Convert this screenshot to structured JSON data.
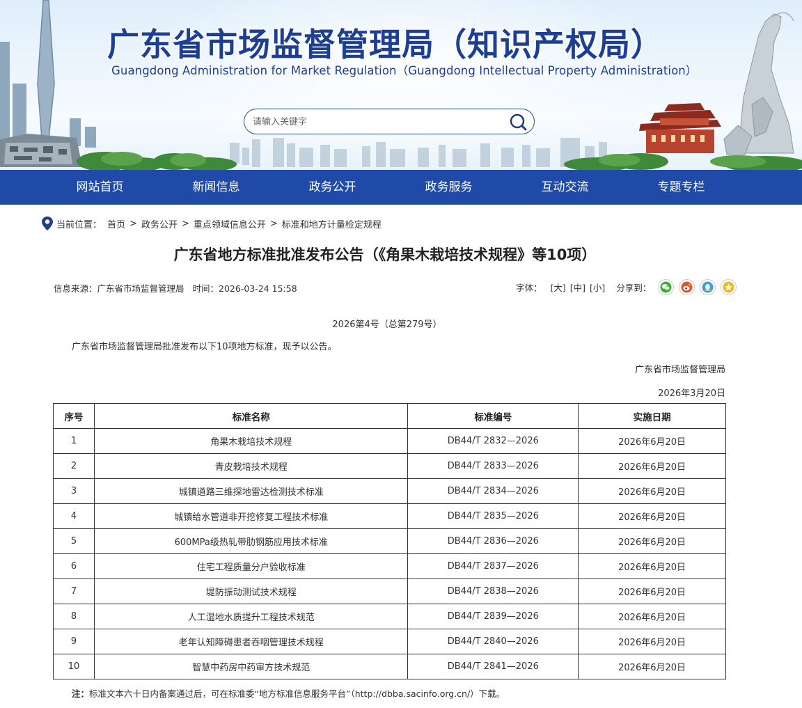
{
  "header": {
    "title_cn": "广东省市场监督管理局（知识产权局）",
    "title_en": "Guangdong Administration for Market Regulation（Guangdong Intellectual Property Administration）",
    "search_placeholder": "请输入关键字"
  },
  "nav": {
    "items": [
      "网站首页",
      "新闻信息",
      "政务公开",
      "政务服务",
      "互动交流",
      "专题专栏"
    ]
  },
  "breadcrumb": {
    "label": "当前位置：",
    "items": [
      "首页",
      "政务公开",
      "重点领域信息公开",
      "标准和地方计量检定规程"
    ],
    "separator": ">"
  },
  "article": {
    "title": "广东省地方标准批准发布公告（《角果木栽培技术规程》等10项）",
    "source": "信息来源：广东省市场监督管理局",
    "time": "时间：2026-03-24 15:58",
    "font_label": "字体：",
    "font_sizes": [
      "[大]",
      "[中]",
      "[小]"
    ],
    "share_label": "分享到：",
    "share_icons": [
      "wechat-icon",
      "weibo-icon",
      "qq-icon",
      "qzone-icon"
    ],
    "doc_no": "2026第4号（总第279号）",
    "intro": "广东省市场监督管理局批准发布以下10项地方标准，现予以公告。",
    "sign_org": "广东省市场监督管理局",
    "sign_date": "2026年3月20日",
    "note_label": "注：",
    "note_text": "标准文本六十日内备案通过后，可在标准委“地方标准信息服务平台”（http://dbba.sacinfo.org.cn/）下载。"
  },
  "table": {
    "headers": [
      "序号",
      "标准名称",
      "标准编号",
      "实施日期"
    ],
    "rows": [
      [
        "1",
        "角果木栽培技术规程",
        "DB44/T 2832—2026",
        "2026年6月20日"
      ],
      [
        "2",
        "青皮栽培技术规程",
        "DB44/T 2833—2026",
        "2026年6月20日"
      ],
      [
        "3",
        "城镇道路三维探地雷达检测技术标准",
        "DB44/T 2834—2026",
        "2026年6月20日"
      ],
      [
        "4",
        "城镇给水管道非开挖修复工程技术标准",
        "DB44/T 2835—2026",
        "2026年6月20日"
      ],
      [
        "5",
        "600MPa级热轧带肋钢筋应用技术标准",
        "DB44/T 2836—2026",
        "2026年6月20日"
      ],
      [
        "6",
        "住宅工程质量分户验收标准",
        "DB44/T 2837—2026",
        "2026年6月20日"
      ],
      [
        "7",
        "堤防振动测试技术规程",
        "DB44/T 2838—2026",
        "2026年6月20日"
      ],
      [
        "8",
        "人工湿地水质提升工程技术规范",
        "DB44/T 2839—2026",
        "2026年6月20日"
      ],
      [
        "9",
        "老年认知障碍患者吞咽管理技术规程",
        "DB44/T 2840—2026",
        "2026年6月20日"
      ],
      [
        "10",
        "智慧中药房中药审方技术规范",
        "DB44/T 2841—2026",
        "2026年6月20日"
      ]
    ]
  },
  "colors": {
    "nav_bg": "#1f4aa7",
    "title_blue": "#1d3f93",
    "wechat": "#3cb034",
    "weibo": "#e2552b",
    "qq": "#3aa0e6",
    "qzone": "#f2b81b"
  }
}
